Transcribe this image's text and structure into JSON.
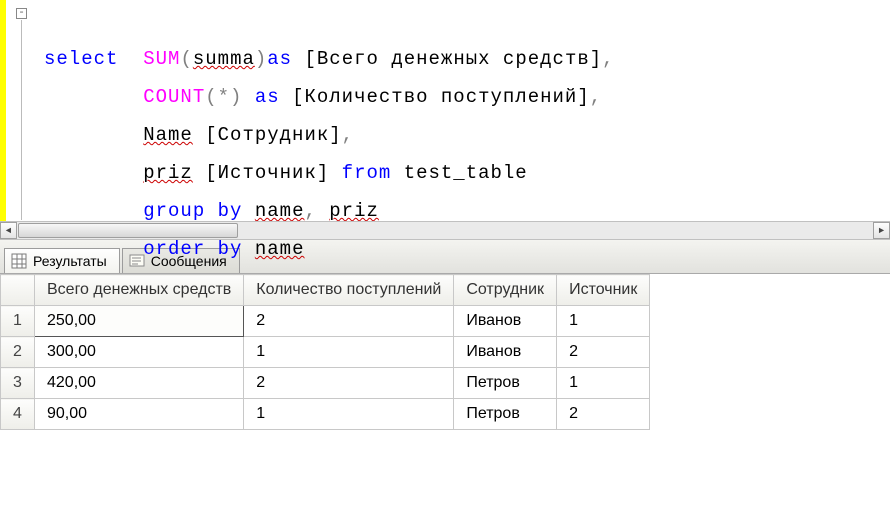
{
  "sql": {
    "line1": {
      "kw_select": "select",
      "func_sum": "SUM",
      "arg_sum": "summa",
      "kw_as": "as",
      "alias1": "[Всего денежных средств]"
    },
    "line2": {
      "func_count": "COUNT",
      "star": "(*)",
      "kw_as": "as",
      "alias2": "[Количество поступлений]"
    },
    "line3": {
      "col_name": "Name",
      "alias3": "[Сотрудник]"
    },
    "line4": {
      "col_priz": "priz",
      "alias4": "[Источник]",
      "kw_from": "from",
      "table": "test_table"
    },
    "line5": {
      "kw_group": "group",
      "kw_by": "by",
      "c1": "name",
      "c2": "priz"
    },
    "line6": {
      "kw_order": "order",
      "kw_by": "by",
      "c1": "name"
    }
  },
  "tabs": {
    "results": "Результаты",
    "messages": "Сообщения"
  },
  "grid": {
    "headers": [
      "Всего денежных средств",
      "Количество поступлений",
      "Сотрудник",
      "Источник"
    ],
    "rows": [
      [
        "250,00",
        "2",
        "Иванов",
        "1"
      ],
      [
        "300,00",
        "1",
        "Иванов",
        "2"
      ],
      [
        "420,00",
        "2",
        "Петров",
        "1"
      ],
      [
        "90,00",
        "1",
        "Петров",
        "2"
      ]
    ],
    "rownums": [
      "1",
      "2",
      "3",
      "4"
    ]
  },
  "gutter": {
    "collapse": "-"
  },
  "scroll": {
    "left": "◄",
    "right": "►"
  }
}
